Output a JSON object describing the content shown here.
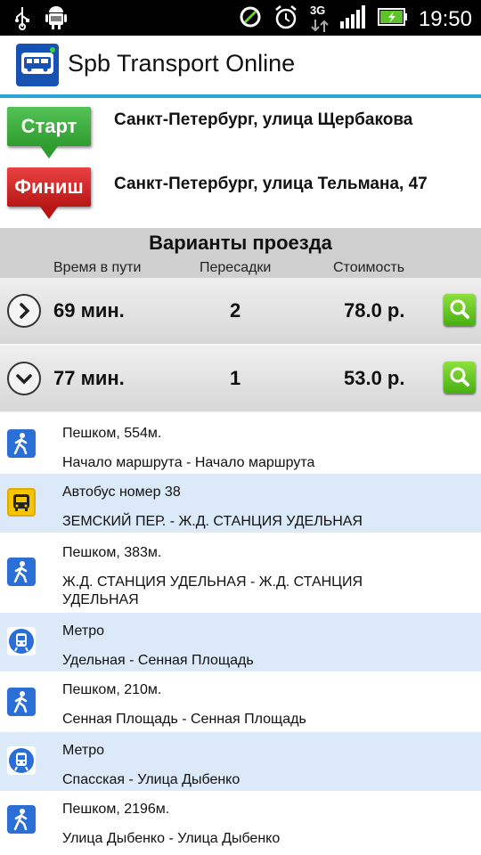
{
  "status": {
    "time": "19:50",
    "network": "3G"
  },
  "app": {
    "title": "Spb Transport Online"
  },
  "route": {
    "start": {
      "label": "Старт",
      "address": "Санкт-Петербург, улица Щербакова"
    },
    "finish": {
      "label": "Финиш",
      "address": "Санкт-Петербург, улица Тельмана, 47"
    }
  },
  "variants": {
    "title": "Варианты проезда",
    "columns": [
      "Время в пути",
      "Пересадки",
      "Стоимость"
    ],
    "options": [
      {
        "time": "69 мин.",
        "transfers": "2",
        "cost": "78.0 р.",
        "expanded": false
      },
      {
        "time": "77 мин.",
        "transfers": "1",
        "cost": "53.0 р.",
        "expanded": true
      }
    ]
  },
  "segments": [
    {
      "icon": "walk-icon",
      "line1": "Пешком, 554м.",
      "line2": "Начало маршрута - Начало маршрута"
    },
    {
      "icon": "bus-icon",
      "line1": "Автобус номер 38",
      "line2": "ЗЕМСКИЙ ПЕР. - Ж.Д. СТАНЦИЯ  УДЕЛЬНАЯ"
    },
    {
      "icon": "walk-icon",
      "line1": "Пешком, 383м.",
      "line2": "Ж.Д. СТАНЦИЯ  УДЕЛЬНАЯ - Ж.Д. СТАНЦИЯ  УДЕЛЬНАЯ"
    },
    {
      "icon": "metro-icon",
      "line1": "Метро",
      "line2": "Удельная - Сенная Площадь"
    },
    {
      "icon": "walk-icon",
      "line1": "Пешком, 210м.",
      "line2": "Сенная Площадь - Сенная Площадь"
    },
    {
      "icon": "metro-icon",
      "line1": "Метро",
      "line2": "Спасская - Улица Дыбенко"
    },
    {
      "icon": "walk-icon",
      "line1": "Пешком, 2196м.",
      "line2": "Улица Дыбенко - Улица Дыбенко"
    }
  ],
  "colors": {
    "accent": "#2aa5de",
    "start": "#3aa93a",
    "finish": "#cc1f1f",
    "alt_row": "#dce9f8"
  }
}
